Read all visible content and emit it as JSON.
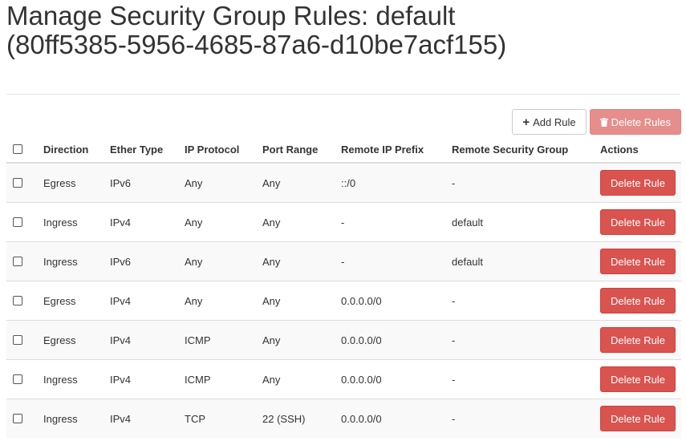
{
  "page": {
    "title": "Manage Security Group Rules: default (80ff5385-5956-4685-87a6-d10be7acf155)"
  },
  "toolbar": {
    "add_rule_label": "Add Rule",
    "delete_rules_label": "Delete Rules"
  },
  "table": {
    "columns": [
      "Direction",
      "Ether Type",
      "IP Protocol",
      "Port Range",
      "Remote IP Prefix",
      "Remote Security Group",
      "Actions"
    ],
    "rows": [
      {
        "direction": "Egress",
        "ether_type": "IPv6",
        "ip_protocol": "Any",
        "port_range": "Any",
        "remote_ip_prefix": "::/0",
        "remote_security_group": "-",
        "action": "Delete Rule"
      },
      {
        "direction": "Ingress",
        "ether_type": "IPv4",
        "ip_protocol": "Any",
        "port_range": "Any",
        "remote_ip_prefix": "-",
        "remote_security_group": "default",
        "action": "Delete Rule"
      },
      {
        "direction": "Ingress",
        "ether_type": "IPv6",
        "ip_protocol": "Any",
        "port_range": "Any",
        "remote_ip_prefix": "-",
        "remote_security_group": "default",
        "action": "Delete Rule"
      },
      {
        "direction": "Egress",
        "ether_type": "IPv4",
        "ip_protocol": "Any",
        "port_range": "Any",
        "remote_ip_prefix": "0.0.0.0/0",
        "remote_security_group": "-",
        "action": "Delete Rule"
      },
      {
        "direction": "Egress",
        "ether_type": "IPv4",
        "ip_protocol": "ICMP",
        "port_range": "Any",
        "remote_ip_prefix": "0.0.0.0/0",
        "remote_security_group": "-",
        "action": "Delete Rule"
      },
      {
        "direction": "Ingress",
        "ether_type": "IPv4",
        "ip_protocol": "ICMP",
        "port_range": "Any",
        "remote_ip_prefix": "0.0.0.0/0",
        "remote_security_group": "-",
        "action": "Delete Rule"
      },
      {
        "direction": "Ingress",
        "ether_type": "IPv4",
        "ip_protocol": "TCP",
        "port_range": "22 (SSH)",
        "remote_ip_prefix": "0.0.0.0/0",
        "remote_security_group": "-",
        "action": "Delete Rule"
      }
    ]
  },
  "icons": {
    "add": "plus-icon",
    "delete": "trash-icon"
  },
  "colors": {
    "danger": "#d9534f",
    "text": "#333333",
    "border": "#dddddd",
    "stripe": "#f9f9f9"
  }
}
